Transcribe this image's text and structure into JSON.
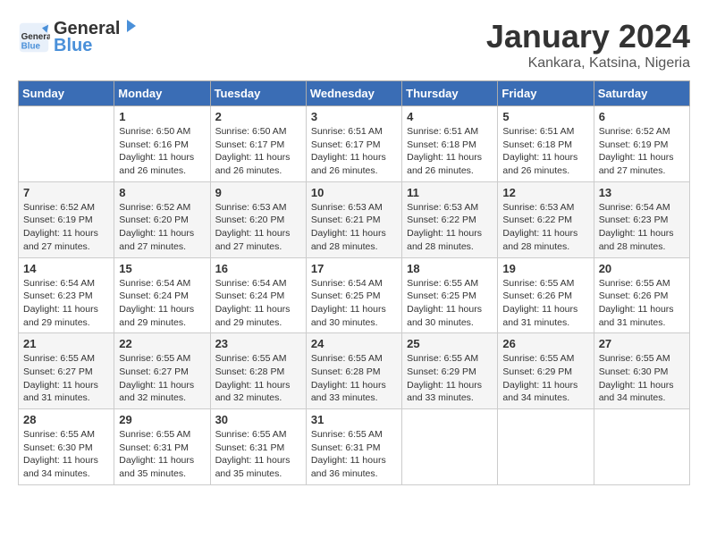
{
  "header": {
    "logo_line1": "General",
    "logo_line2": "Blue",
    "month_title": "January 2024",
    "location": "Kankara, Katsina, Nigeria"
  },
  "days_of_week": [
    "Sunday",
    "Monday",
    "Tuesday",
    "Wednesday",
    "Thursday",
    "Friday",
    "Saturday"
  ],
  "weeks": [
    [
      {
        "num": "",
        "info": ""
      },
      {
        "num": "1",
        "info": "Sunrise: 6:50 AM\nSunset: 6:16 PM\nDaylight: 11 hours\nand 26 minutes."
      },
      {
        "num": "2",
        "info": "Sunrise: 6:50 AM\nSunset: 6:17 PM\nDaylight: 11 hours\nand 26 minutes."
      },
      {
        "num": "3",
        "info": "Sunrise: 6:51 AM\nSunset: 6:17 PM\nDaylight: 11 hours\nand 26 minutes."
      },
      {
        "num": "4",
        "info": "Sunrise: 6:51 AM\nSunset: 6:18 PM\nDaylight: 11 hours\nand 26 minutes."
      },
      {
        "num": "5",
        "info": "Sunrise: 6:51 AM\nSunset: 6:18 PM\nDaylight: 11 hours\nand 26 minutes."
      },
      {
        "num": "6",
        "info": "Sunrise: 6:52 AM\nSunset: 6:19 PM\nDaylight: 11 hours\nand 27 minutes."
      }
    ],
    [
      {
        "num": "7",
        "info": "Sunrise: 6:52 AM\nSunset: 6:19 PM\nDaylight: 11 hours\nand 27 minutes."
      },
      {
        "num": "8",
        "info": "Sunrise: 6:52 AM\nSunset: 6:20 PM\nDaylight: 11 hours\nand 27 minutes."
      },
      {
        "num": "9",
        "info": "Sunrise: 6:53 AM\nSunset: 6:20 PM\nDaylight: 11 hours\nand 27 minutes."
      },
      {
        "num": "10",
        "info": "Sunrise: 6:53 AM\nSunset: 6:21 PM\nDaylight: 11 hours\nand 28 minutes."
      },
      {
        "num": "11",
        "info": "Sunrise: 6:53 AM\nSunset: 6:22 PM\nDaylight: 11 hours\nand 28 minutes."
      },
      {
        "num": "12",
        "info": "Sunrise: 6:53 AM\nSunset: 6:22 PM\nDaylight: 11 hours\nand 28 minutes."
      },
      {
        "num": "13",
        "info": "Sunrise: 6:54 AM\nSunset: 6:23 PM\nDaylight: 11 hours\nand 28 minutes."
      }
    ],
    [
      {
        "num": "14",
        "info": "Sunrise: 6:54 AM\nSunset: 6:23 PM\nDaylight: 11 hours\nand 29 minutes."
      },
      {
        "num": "15",
        "info": "Sunrise: 6:54 AM\nSunset: 6:24 PM\nDaylight: 11 hours\nand 29 minutes."
      },
      {
        "num": "16",
        "info": "Sunrise: 6:54 AM\nSunset: 6:24 PM\nDaylight: 11 hours\nand 29 minutes."
      },
      {
        "num": "17",
        "info": "Sunrise: 6:54 AM\nSunset: 6:25 PM\nDaylight: 11 hours\nand 30 minutes."
      },
      {
        "num": "18",
        "info": "Sunrise: 6:55 AM\nSunset: 6:25 PM\nDaylight: 11 hours\nand 30 minutes."
      },
      {
        "num": "19",
        "info": "Sunrise: 6:55 AM\nSunset: 6:26 PM\nDaylight: 11 hours\nand 31 minutes."
      },
      {
        "num": "20",
        "info": "Sunrise: 6:55 AM\nSunset: 6:26 PM\nDaylight: 11 hours\nand 31 minutes."
      }
    ],
    [
      {
        "num": "21",
        "info": "Sunrise: 6:55 AM\nSunset: 6:27 PM\nDaylight: 11 hours\nand 31 minutes."
      },
      {
        "num": "22",
        "info": "Sunrise: 6:55 AM\nSunset: 6:27 PM\nDaylight: 11 hours\nand 32 minutes."
      },
      {
        "num": "23",
        "info": "Sunrise: 6:55 AM\nSunset: 6:28 PM\nDaylight: 11 hours\nand 32 minutes."
      },
      {
        "num": "24",
        "info": "Sunrise: 6:55 AM\nSunset: 6:28 PM\nDaylight: 11 hours\nand 33 minutes."
      },
      {
        "num": "25",
        "info": "Sunrise: 6:55 AM\nSunset: 6:29 PM\nDaylight: 11 hours\nand 33 minutes."
      },
      {
        "num": "26",
        "info": "Sunrise: 6:55 AM\nSunset: 6:29 PM\nDaylight: 11 hours\nand 34 minutes."
      },
      {
        "num": "27",
        "info": "Sunrise: 6:55 AM\nSunset: 6:30 PM\nDaylight: 11 hours\nand 34 minutes."
      }
    ],
    [
      {
        "num": "28",
        "info": "Sunrise: 6:55 AM\nSunset: 6:30 PM\nDaylight: 11 hours\nand 34 minutes."
      },
      {
        "num": "29",
        "info": "Sunrise: 6:55 AM\nSunset: 6:31 PM\nDaylight: 11 hours\nand 35 minutes."
      },
      {
        "num": "30",
        "info": "Sunrise: 6:55 AM\nSunset: 6:31 PM\nDaylight: 11 hours\nand 35 minutes."
      },
      {
        "num": "31",
        "info": "Sunrise: 6:55 AM\nSunset: 6:31 PM\nDaylight: 11 hours\nand 36 minutes."
      },
      {
        "num": "",
        "info": ""
      },
      {
        "num": "",
        "info": ""
      },
      {
        "num": "",
        "info": ""
      }
    ]
  ]
}
